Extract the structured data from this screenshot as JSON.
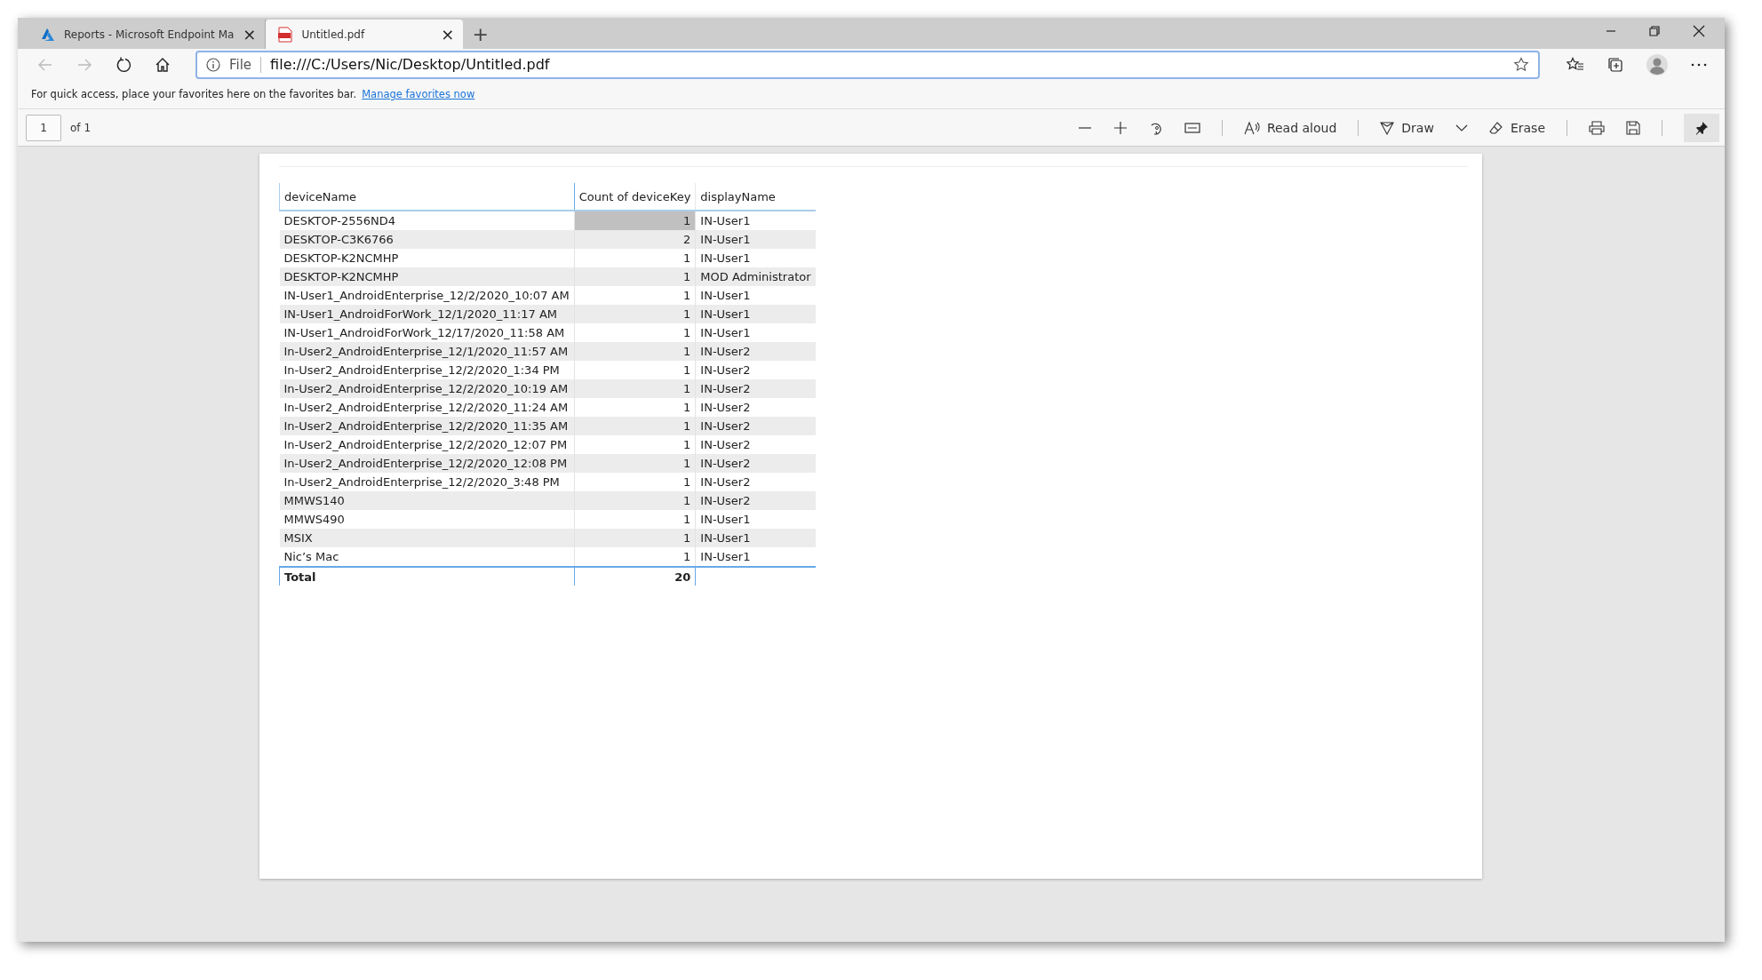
{
  "tabs": [
    {
      "title": "Reports - Microsoft Endpoint Ma",
      "kind": "portal",
      "selected": false,
      "close": "×"
    },
    {
      "title": "Untitled.pdf",
      "kind": "pdf",
      "selected": true,
      "close": "×"
    }
  ],
  "new_tab": "+",
  "address_bar": {
    "scheme": "File",
    "value": "file:///C:/Users/Nic/Desktop/Untitled.pdf"
  },
  "favorites_bar": {
    "message": "For quick access, place your favorites here on the favorites bar.",
    "link": "Manage favorites now"
  },
  "pdf_toolbar": {
    "page": "1",
    "page_count": "of 1",
    "read_aloud": "Read aloud",
    "draw": "Draw",
    "erase": "Erase",
    "pinned": true
  },
  "table": {
    "columns": [
      "deviceName",
      "Count of deviceKey",
      "displayName"
    ],
    "rows": [
      {
        "cells": [
          "DESKTOP-2556ND4",
          "1",
          "IN-User1"
        ],
        "selected": true
      },
      {
        "cells": [
          "DESKTOP-C3K6766",
          "2",
          "IN-User1"
        ],
        "selected": false
      },
      {
        "cells": [
          "DESKTOP-K2NCMHP",
          "1",
          "IN-User1"
        ],
        "selected": false
      },
      {
        "cells": [
          "DESKTOP-K2NCMHP",
          "1",
          "MOD Administrator"
        ],
        "selected": false
      },
      {
        "cells": [
          "IN-User1_AndroidEnterprise_12/2/2020_10:07 AM",
          "1",
          "IN-User1"
        ],
        "selected": false
      },
      {
        "cells": [
          "IN-User1_AndroidForWork_12/1/2020_11:17 AM",
          "1",
          "IN-User1"
        ],
        "selected": false
      },
      {
        "cells": [
          "IN-User1_AndroidForWork_12/17/2020_11:58 AM",
          "1",
          "IN-User1"
        ],
        "selected": false
      },
      {
        "cells": [
          "In-User2_AndroidEnterprise_12/1/2020_11:57 AM",
          "1",
          "IN-User2"
        ],
        "selected": false
      },
      {
        "cells": [
          "In-User2_AndroidEnterprise_12/2/2020_1:34 PM",
          "1",
          "IN-User2"
        ],
        "selected": false
      },
      {
        "cells": [
          "In-User2_AndroidEnterprise_12/2/2020_10:19 AM",
          "1",
          "IN-User2"
        ],
        "selected": false
      },
      {
        "cells": [
          "In-User2_AndroidEnterprise_12/2/2020_11:24 AM",
          "1",
          "IN-User2"
        ],
        "selected": false
      },
      {
        "cells": [
          "In-User2_AndroidEnterprise_12/2/2020_11:35 AM",
          "1",
          "IN-User2"
        ],
        "selected": false
      },
      {
        "cells": [
          "In-User2_AndroidEnterprise_12/2/2020_12:07 PM",
          "1",
          "IN-User2"
        ],
        "selected": false
      },
      {
        "cells": [
          "In-User2_AndroidEnterprise_12/2/2020_12:08 PM",
          "1",
          "IN-User2"
        ],
        "selected": false
      },
      {
        "cells": [
          "In-User2_AndroidEnterprise_12/2/2020_3:48 PM",
          "1",
          "IN-User2"
        ],
        "selected": false
      },
      {
        "cells": [
          "MMWS140",
          "1",
          "IN-User2"
        ],
        "selected": false
      },
      {
        "cells": [
          "MMWS490",
          "1",
          "IN-User1"
        ],
        "selected": false
      },
      {
        "cells": [
          "MSIX",
          "1",
          "IN-User1"
        ],
        "selected": false
      },
      {
        "cells": [
          "Nic’s Mac",
          "1",
          "IN-User1"
        ],
        "selected": false
      }
    ],
    "total": {
      "label": "Total",
      "value": "20"
    }
  }
}
